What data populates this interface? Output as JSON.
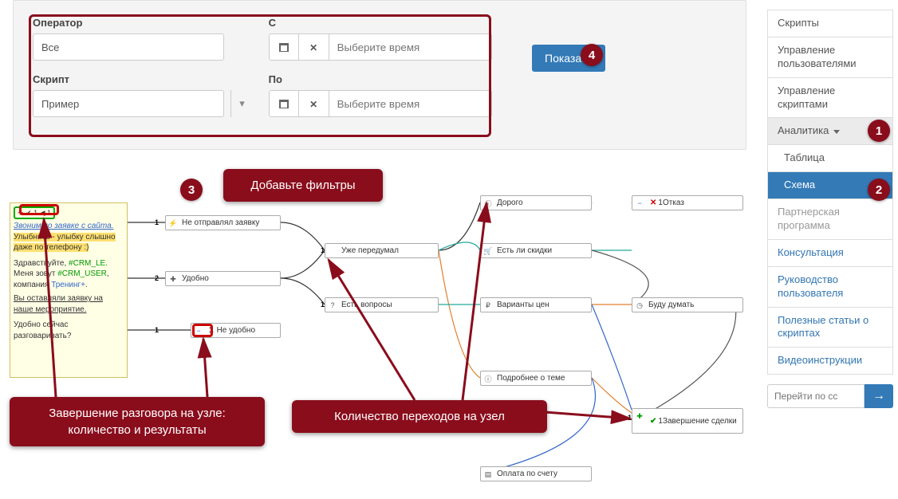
{
  "filters": {
    "operator_label": "Оператор",
    "operator_value": "Все",
    "script_label": "Скрипт",
    "script_value": "Пример",
    "from_label": "С",
    "to_label": "По",
    "time_placeholder": "Выберите время",
    "show_label": "Показать"
  },
  "sidebar": {
    "items": [
      {
        "label": "Скрипты"
      },
      {
        "label": "Управление пользователями"
      },
      {
        "label": "Управление скриптами"
      },
      {
        "label": "Аналитика"
      },
      {
        "label": "Таблица"
      },
      {
        "label": "Схема"
      },
      {
        "label": "Партнерская программа"
      },
      {
        "label": "Консультация"
      },
      {
        "label": "Руководство пользователя"
      },
      {
        "label": "Полезные статьи о скриптах"
      },
      {
        "label": "Видеоинструкции"
      }
    ],
    "go_placeholder": "Перейти по сс"
  },
  "callouts": {
    "filters": "Добавьте фильтры",
    "node_end": "Завершение разговора на узле: количество и результаты",
    "transitions": "Количество переходов на узел"
  },
  "badges": {
    "1": "1",
    "2": "2",
    "3": "3",
    "4": "4"
  },
  "diagram": {
    "start_icons": "✈ ✔ 1 ◀ 1",
    "start_line1": "Звоним по заявке с сайта.",
    "start_line2": "Улыбнись - улыбку слышно даже по телефону :)",
    "start_line3_a": "Здравствуйте, ",
    "start_crm1": "#CRM_LE.",
    "start_line3_b": " Меня зовут ",
    "start_crm2": "#CRM_USER",
    "start_line3_c": ", компания ",
    "start_link": "Тренинг+",
    "start_line4": "Вы оставляли заявку на наше мероприятие.",
    "start_line5": "Удобно сейчас разговаривать?",
    "nodes": {
      "n1": "Не отправлял заявку",
      "n2": "Удобно",
      "n3": "Не удобно",
      "n4": "Уже передумал",
      "n5": "Есть вопросы",
      "n6": "Дорого",
      "n7": "Есть ли скидки",
      "n8": "Варианты цен",
      "n9": "Подробнее о теме",
      "n10": "1Отказ",
      "n11": "Буду думать",
      "n12": "1Завершение сделки",
      "n13": "Оплата по счету"
    },
    "edge_labels": {
      "e1": "1",
      "e2": "2",
      "e3": "1",
      "e4": "1",
      "e5": "1",
      "e6": "1"
    },
    "n3_badge": "1"
  }
}
